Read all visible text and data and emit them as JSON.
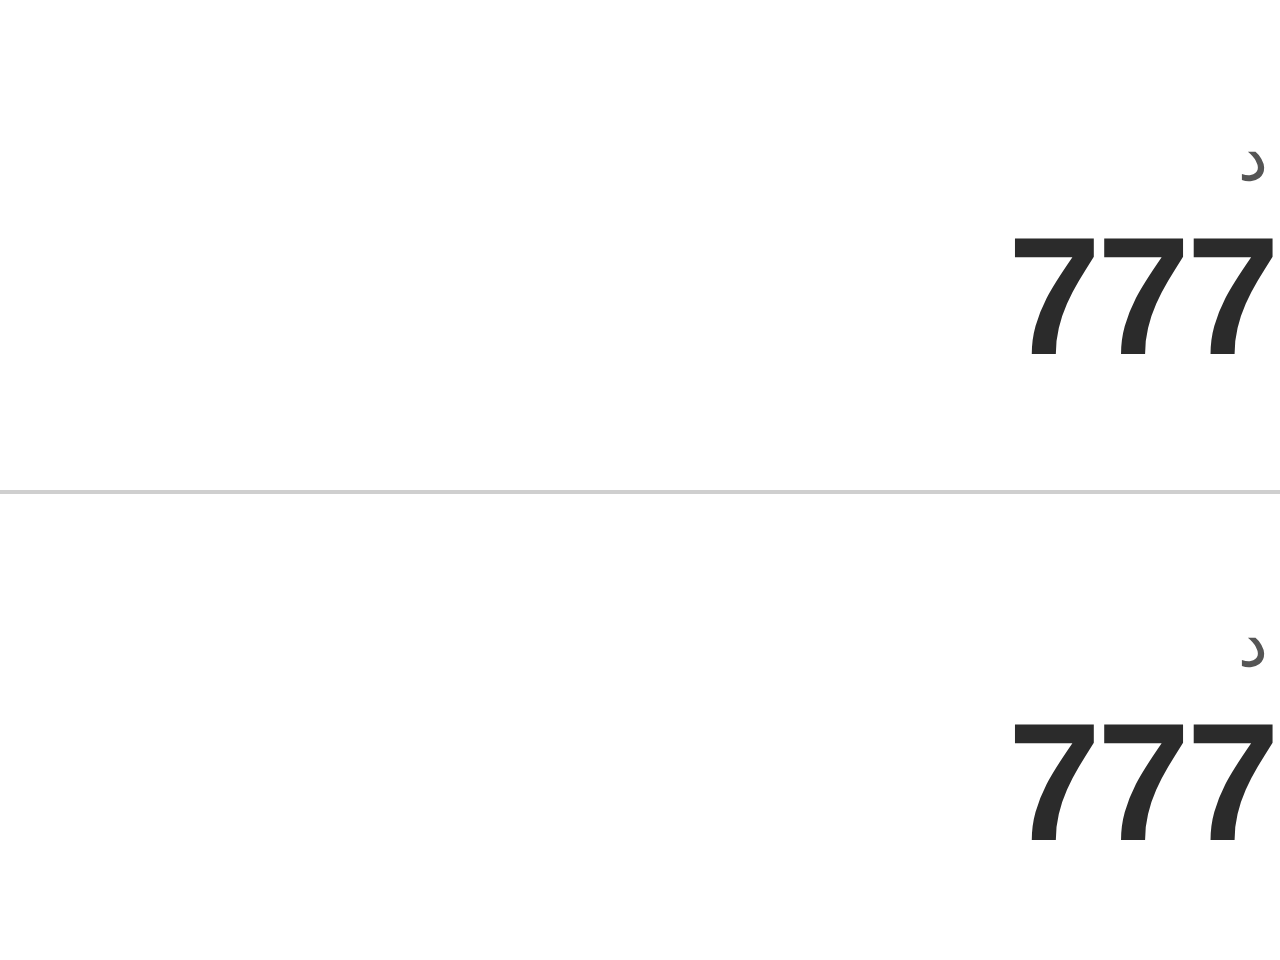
{
  "rows": [
    {
      "label": "د",
      "number": "777"
    },
    {
      "label": "د",
      "number": "777"
    }
  ]
}
